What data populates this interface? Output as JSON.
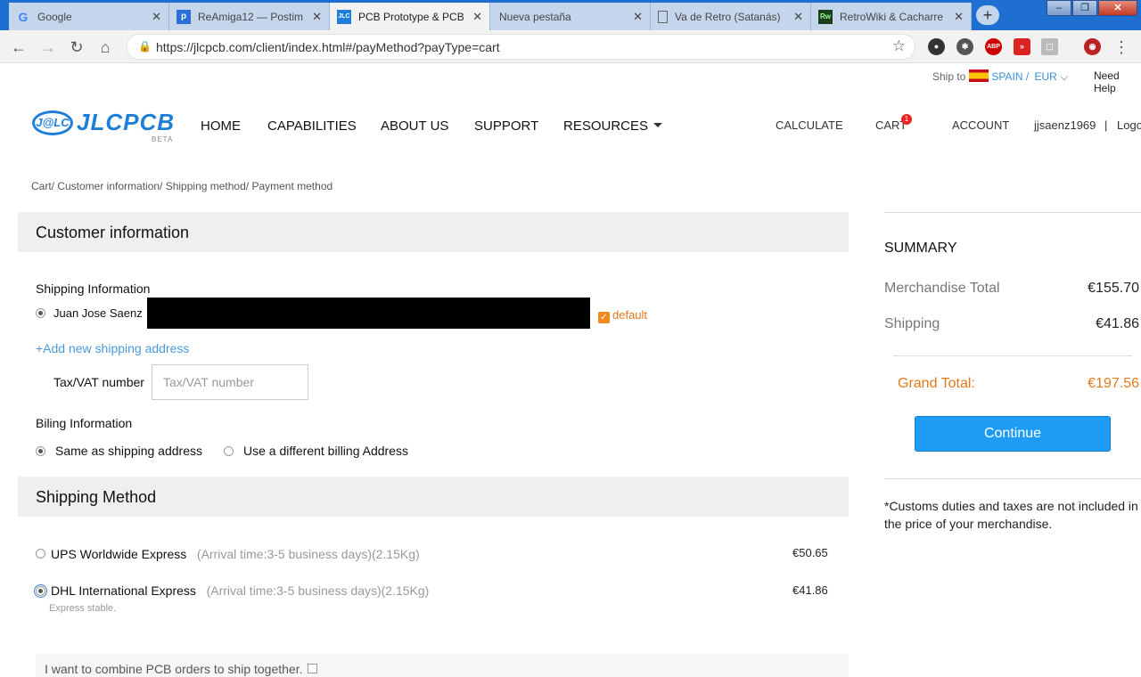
{
  "browser": {
    "tabs": [
      {
        "title": "Google",
        "favicon": "G",
        "favicon_color": "#4285f4"
      },
      {
        "title": "ReAmiga12 — Postim",
        "favicon": "p",
        "favicon_color": "#2b6fd6"
      },
      {
        "title": "PCB Prototype & PCB",
        "favicon": "JLC",
        "favicon_color": "#1f7fd8",
        "active": true
      },
      {
        "title": "Nueva pestaña",
        "favicon": "",
        "favicon_color": ""
      },
      {
        "title": "Va de Retro (Satanás)",
        "favicon": "doc",
        "favicon_color": "#666"
      },
      {
        "title": "RetroWiki & Cacharre",
        "favicon": "Rw",
        "favicon_color": "#1a5f1a"
      }
    ],
    "new_tab": "+",
    "url": "https://jlcpcb.com/client/index.html#/payMethod?payType=cart"
  },
  "header": {
    "ship_to_label": "Ship to",
    "country": "SPAIN /",
    "currency": "EUR",
    "need_help": "Need Help",
    "logo_mark": "J@LC",
    "logo_word": "JLCPCB",
    "logo_beta": "BETA",
    "nav": [
      "HOME",
      "CAPABILITIES",
      "ABOUT US",
      "SUPPORT",
      "RESOURCES"
    ],
    "right_nav": {
      "calculate": "CALCULATE",
      "cart": "CART",
      "cart_count": "1",
      "account": "ACCOUNT",
      "user": "jjsaenz1969",
      "sep": "|",
      "logout": "Logo"
    }
  },
  "breadcrumb": "Cart/ Customer information/ Shipping method/ Payment method",
  "customer": {
    "title": "Customer information",
    "shipping_info_label": "Shipping Information",
    "address_name": "Juan Jose Saenz",
    "default_label": "default",
    "add_address": "+Add new shipping address",
    "tax_label": "Tax/VAT number",
    "tax_placeholder": "Tax/VAT number",
    "billing_label": "Biling Information",
    "billing_same": "Same as shipping address",
    "billing_different": "Use a different billing Address"
  },
  "shipping": {
    "title": "Shipping Method",
    "options": [
      {
        "name": "UPS Worldwide Express",
        "detail": "(Arrival time:3-5 business days)(2.15Kg)",
        "price": "€50.65",
        "selected": false
      },
      {
        "name": "DHL International Express",
        "detail": "(Arrival time:3-5 business days)(2.15Kg)",
        "price": "€41.86",
        "selected": true
      }
    ],
    "note": "Express stable.",
    "combine_label": "I want to combine PCB orders to ship together."
  },
  "summary": {
    "title": "SUMMARY",
    "merchandise_label": "Merchandise Total",
    "merchandise_value": "€155.70",
    "shipping_label": "Shipping",
    "shipping_value": "€41.86",
    "grand_label": "Grand Total:",
    "grand_value": "€197.56",
    "continue": "Continue",
    "customs_note": "*Customs duties and taxes are not included in the price of your merchandise."
  },
  "colors": {
    "brand": "#1f7fd8",
    "accent": "#e07a1a",
    "button": "#1e9bf5"
  }
}
